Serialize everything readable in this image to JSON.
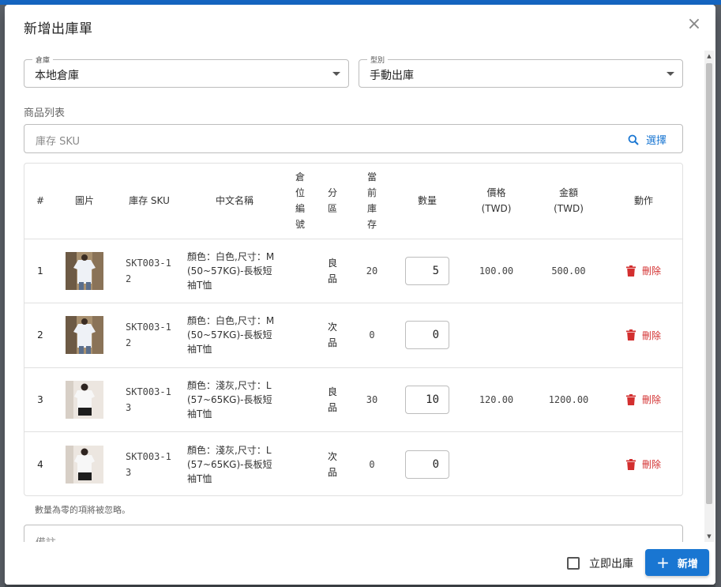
{
  "dialog": {
    "title": "新增出庫單",
    "close_glyph": "×"
  },
  "warehouse": {
    "legend": "倉庫",
    "value": "本地倉庫"
  },
  "type": {
    "legend": "型別",
    "value": "手動出庫"
  },
  "product_section": {
    "label": "商品列表"
  },
  "search": {
    "placeholder": "庫存 SKU",
    "pick_label": "選擇",
    "icon": "search-icon"
  },
  "table": {
    "headers": {
      "index": "#",
      "image": "圖片",
      "sku": "庫存 SKU",
      "name": "中文名稱",
      "location": "倉位編號",
      "zone": "分區",
      "stock": "當前庫存",
      "qty": "數量",
      "price_line1": "價格",
      "price_line2": "(TWD)",
      "amount_line1": "金額",
      "amount_line2": "(TWD)",
      "action": "動作"
    },
    "rows": [
      {
        "index": "1",
        "sku": "SKT003-12",
        "name": "顏色：白色,尺寸：M (50~57KG)-長板短袖T恤",
        "location": "",
        "zone": "良品",
        "stock": "20",
        "qty": "5",
        "price": "100.00",
        "amount": "500.00",
        "delete_label": "刪除"
      },
      {
        "index": "2",
        "sku": "SKT003-12",
        "name": "顏色：白色,尺寸：M (50~57KG)-長板短袖T恤",
        "location": "",
        "zone": "次品",
        "stock": "0",
        "qty": "0",
        "price": "",
        "amount": "",
        "delete_label": "刪除"
      },
      {
        "index": "3",
        "sku": "SKT003-13",
        "name": "顏色：淺灰,尺寸：L (57~65KG)-長板短袖T恤",
        "location": "",
        "zone": "良品",
        "stock": "30",
        "qty": "10",
        "price": "120.00",
        "amount": "1200.00",
        "delete_label": "刪除"
      },
      {
        "index": "4",
        "sku": "SKT003-13",
        "name": "顏色：淺灰,尺寸：L (57~65KG)-長板短袖T恤",
        "location": "",
        "zone": "次品",
        "stock": "0",
        "qty": "0",
        "price": "",
        "amount": "",
        "delete_label": "刪除"
      }
    ]
  },
  "hint": "數量為零的項將被忽略。",
  "notes": {
    "placeholder": "備註"
  },
  "footer": {
    "checkbox_label": "立即出庫",
    "add_label": "新增"
  },
  "colors": {
    "primary": "#1976d2",
    "danger": "#d32f2f",
    "border": "#bdbdbd"
  }
}
